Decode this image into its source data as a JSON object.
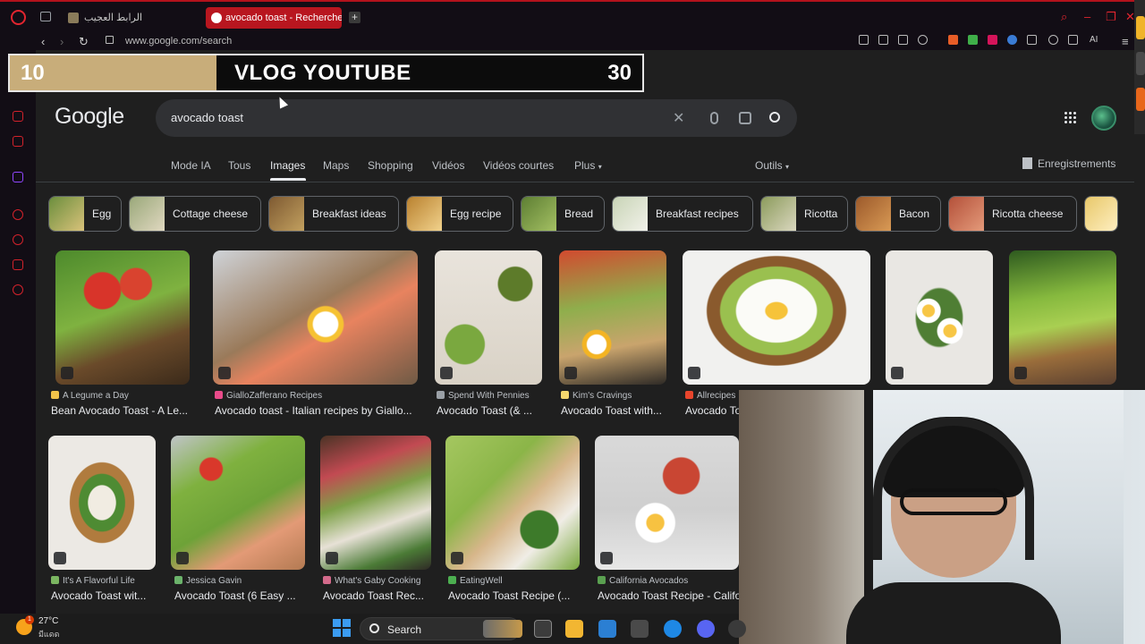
{
  "browser": {
    "tabs": [
      {
        "label": "الرابط العجيب",
        "active": false
      },
      {
        "label": "avocado toast - Recherche",
        "active": true
      }
    ],
    "url": "www.google.com/search",
    "ai_label": "AI"
  },
  "banner": {
    "left_number": "10",
    "title": "VLOG YOUTUBE",
    "right_number": "30"
  },
  "google": {
    "logo": "Google",
    "search_value": "avocado toast",
    "tabs": [
      {
        "label": "Mode IA",
        "active": false
      },
      {
        "label": "Tous",
        "active": false
      },
      {
        "label": "Images",
        "active": true
      },
      {
        "label": "Maps",
        "active": false
      },
      {
        "label": "Shopping",
        "active": false
      },
      {
        "label": "Vidéos",
        "active": false
      },
      {
        "label": "Vidéos courtes",
        "active": false
      },
      {
        "label": "Plus",
        "active": false
      }
    ],
    "tools_label": "Outils",
    "saved_label": "Enregistrements"
  },
  "chips": [
    {
      "label": "Egg",
      "thumb": "#8aa65b"
    },
    {
      "label": "Cottage cheese",
      "thumb": "#b9c59a"
    },
    {
      "label": "Breakfast ideas",
      "thumb": "#9c7a4a"
    },
    {
      "label": "Egg recipe",
      "thumb": "#c89b5a"
    },
    {
      "label": "Bread",
      "thumb": "#7c9b4e"
    },
    {
      "label": "Breakfast recipes",
      "thumb": "#d8e0c8"
    },
    {
      "label": "Ricotta",
      "thumb": "#a7b67a"
    },
    {
      "label": "Bacon",
      "thumb": "#b7833f"
    },
    {
      "label": "Ricotta cheese",
      "thumb": "#c56a4e"
    }
  ],
  "results_row1": [
    {
      "source": "A Legume a Day",
      "title": "Bean Avocado Toast - A Le...",
      "fav": "#f0c24a"
    },
    {
      "source": "GialloZafferano Recipes",
      "title": "Avocado toast - Italian recipes by Giallo...",
      "fav": "#e84b8a"
    },
    {
      "source": "Spend With Pennies",
      "title": "Avocado Toast (& ...",
      "fav": "#9aa0a6"
    },
    {
      "source": "Kim's Cravings",
      "title": "Avocado Toast with...",
      "fav": "#f5d76e"
    },
    {
      "source": "Allrecipes",
      "title": "Avocado To",
      "fav": "#e8452c"
    }
  ],
  "results_row2": [
    {
      "source": "It's A Flavorful Life",
      "title": "Avocado Toast wit...",
      "fav": "#7bb661"
    },
    {
      "source": "Jessica Gavin",
      "title": "Avocado Toast (6 Easy ...",
      "fav": "#6bb36b"
    },
    {
      "source": "What's Gaby Cooking",
      "title": "Avocado Toast Rec...",
      "fav": "#d36a8b"
    },
    {
      "source": "EatingWell",
      "title": "Avocado Toast Recipe (...",
      "fav": "#4caf50"
    },
    {
      "source": "California Avocados",
      "title": "Avocado Toast Recipe - Califo",
      "fav": "#5aa050"
    }
  ],
  "taskbar": {
    "temperature": "27°C",
    "weather_desc": "มีแดด",
    "badge": "1",
    "search_label": "Search"
  }
}
